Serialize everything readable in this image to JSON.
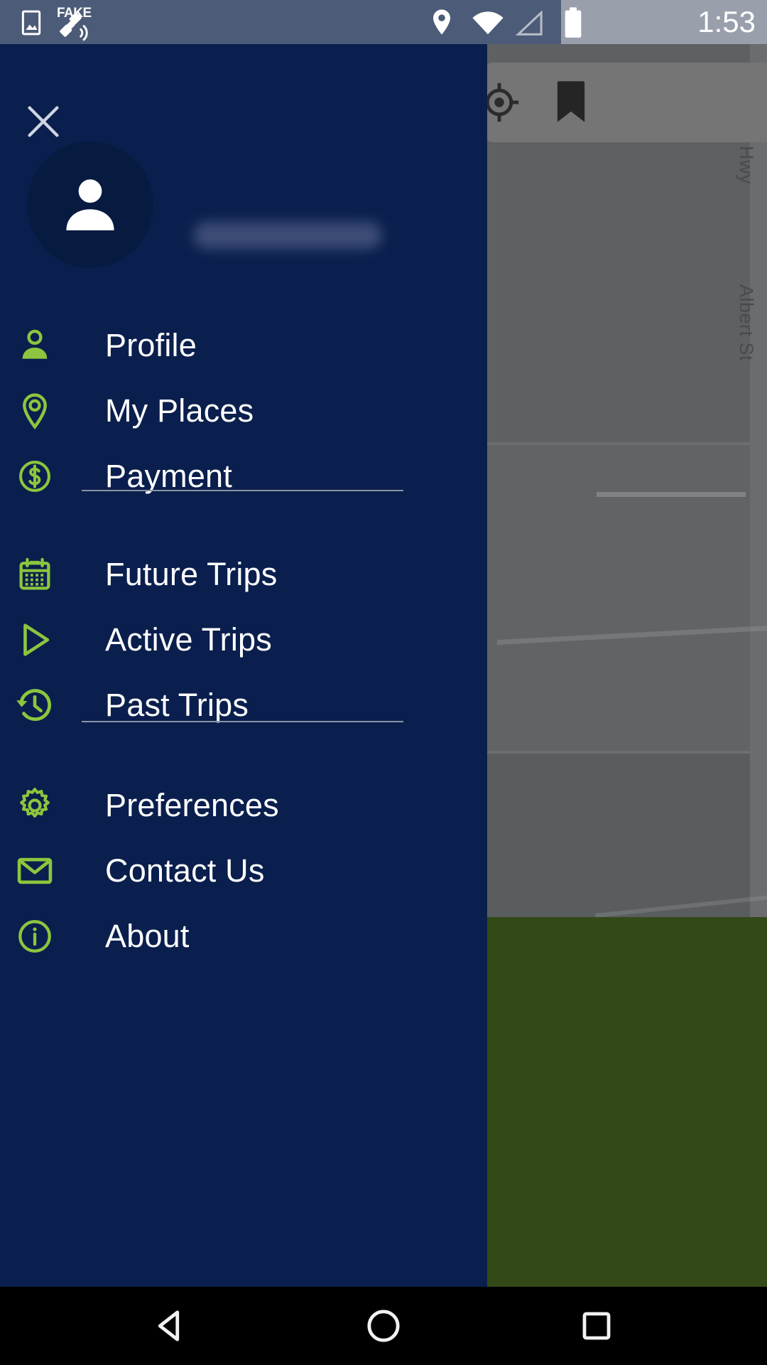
{
  "status_bar": {
    "time": "1:53",
    "fake_gps_label": "FAKE",
    "icons": [
      {
        "name": "image-icon",
        "glyph": "image"
      },
      {
        "name": "fake-gps-satellite-icon",
        "glyph": "satellite"
      },
      {
        "name": "location-pin-icon",
        "glyph": "pin"
      },
      {
        "name": "wifi-icon",
        "glyph": "wifi"
      },
      {
        "name": "cellular-signal-icon",
        "glyph": "signal-triangle"
      },
      {
        "name": "battery-icon",
        "glyph": "battery-full"
      }
    ]
  },
  "drawer": {
    "close_label": "Close",
    "avatar_alt": "User avatar",
    "username": "",
    "groups": [
      {
        "items": [
          {
            "label": "Profile",
            "icon": "person-icon"
          },
          {
            "label": "My Places",
            "icon": "map-pin-icon"
          },
          {
            "label": "Payment",
            "icon": "dollar-circle-icon"
          }
        ]
      },
      {
        "items": [
          {
            "label": "Future Trips",
            "icon": "calendar-icon"
          },
          {
            "label": "Active Trips",
            "icon": "play-triangle-icon"
          },
          {
            "label": "Past Trips",
            "icon": "history-clock-icon"
          }
        ]
      },
      {
        "items": [
          {
            "label": "Preferences",
            "icon": "gear-icon"
          },
          {
            "label": "Contact Us",
            "icon": "envelope-icon"
          },
          {
            "label": "About",
            "icon": "info-circle-icon"
          }
        ]
      }
    ]
  },
  "map": {
    "street_labels": [
      "Can-Am Hwy",
      "Albert St"
    ],
    "controls": [
      {
        "name": "my-location-button",
        "icon": "crosshair-icon"
      },
      {
        "name": "bookmark-button",
        "icon": "bookmark-icon"
      }
    ]
  },
  "nav_bar": {
    "buttons": [
      {
        "name": "back-button",
        "icon": "triangle-left-icon"
      },
      {
        "name": "home-button",
        "icon": "circle-icon"
      },
      {
        "name": "recents-button",
        "icon": "square-icon"
      }
    ]
  },
  "colors": {
    "drawer_bg": "#0a1f4d",
    "accent_green": "#8cc63e",
    "status_bar_bg": "#4c5b77",
    "text_primary": "#ffffff",
    "divider": "#8a94a6",
    "park_green": "#334a18"
  }
}
